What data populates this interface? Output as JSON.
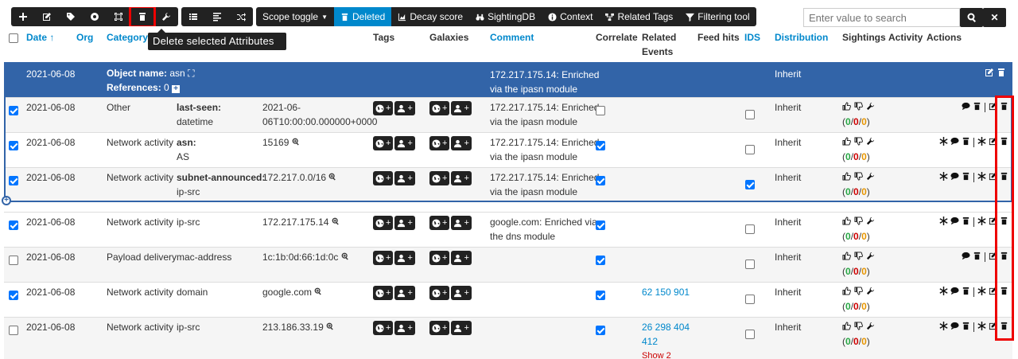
{
  "toolbar": {
    "tooltip": "Delete selected Attributes",
    "scope_toggle": "Scope toggle",
    "deleted": "Deleted",
    "decay_score": "Decay score",
    "sightingdb": "SightingDB",
    "context": "Context",
    "related_tags": "Related Tags",
    "filtering_tool": "Filtering tool"
  },
  "search": {
    "placeholder": "Enter value to search"
  },
  "headers": {
    "date": "Date ↑",
    "org": "Org",
    "category": "Category",
    "tags": "Tags",
    "galaxies": "Galaxies",
    "comment": "Comment",
    "correlate": "Correlate",
    "related": "Related",
    "events": "Events",
    "feed_hits": "Feed hits",
    "ids": "IDS",
    "distribution": "Distribution",
    "sightings": "Sightings",
    "activity": "Activity",
    "actions": "Actions"
  },
  "object_row": {
    "date": "2021-06-08",
    "object_name_label": "Object name:",
    "object_name": "asn",
    "references_label": "References:",
    "references": "0",
    "comment1": "172.217.175.14: Enriched",
    "comment2": "via the ipasn module",
    "distribution": "Inherit"
  },
  "rows": [
    {
      "date": "2021-06-08",
      "category": "Other",
      "type1": "last-seen:",
      "type2": "datetime",
      "value1": "2021-06-",
      "value2": "06T10:00:00.000000+0000",
      "comment1": "172.217.175.14: Enriched",
      "comment2": "via the ipasn module",
      "distribution": "Inherit",
      "sightings": "0",
      "s1": "0",
      "s2": "0",
      "s3": "0"
    },
    {
      "date": "2021-06-08",
      "category": "Network activity",
      "type1": "asn:",
      "type2": "AS",
      "value1": "15169",
      "comment1": "172.217.175.14: Enriched",
      "comment2": "via the ipasn module",
      "distribution": "Inherit",
      "sightings": "0",
      "s1": "0",
      "s2": "0",
      "s3": "0"
    },
    {
      "date": "2021-06-08",
      "category": "Network activity",
      "type1": "subnet-announced:",
      "type2": "ip-src",
      "value1": "172.217.0.0/16",
      "comment1": "172.217.175.14: Enriched",
      "comment2": "via the ipasn module",
      "distribution": "Inherit",
      "sightings": "0",
      "s1": "0",
      "s2": "0",
      "s3": "0"
    },
    {
      "date": "2021-06-08",
      "category": "Network activity",
      "type1": "ip-src",
      "value1": "172.217.175.14",
      "comment1": "google.com: Enriched via",
      "comment2": "the dns module",
      "distribution": "Inherit",
      "sightings": "0",
      "s1": "0",
      "s2": "0",
      "s3": "0"
    },
    {
      "date": "2021-06-08",
      "category": "Payload delivery",
      "type1": "mac-address",
      "value1": "1c:1b:0d:66:1d:0c",
      "distribution": "Inherit",
      "sightings": "0",
      "s1": "0",
      "s2": "0",
      "s3": "0"
    },
    {
      "date": "2021-06-08",
      "category": "Network activity",
      "type1": "domain",
      "value1": "google.com",
      "related1": "62 150 901",
      "distribution": "Inherit",
      "sightings": "0",
      "s1": "0",
      "s2": "0",
      "s3": "0"
    },
    {
      "date": "2021-06-08",
      "category": "Network activity",
      "type1": "ip-src",
      "value1": "213.186.33.19",
      "related1": "26 298 404",
      "related2": "412",
      "show_more": "Show 2",
      "distribution": "Inherit",
      "sightings": "0",
      "s1": "0",
      "s2": "0",
      "s3": "0"
    }
  ],
  "colors": {
    "accent": "#0088cc",
    "object_row": "#3264a8",
    "highlight": "#e00000",
    "toolbar": "#222222"
  }
}
